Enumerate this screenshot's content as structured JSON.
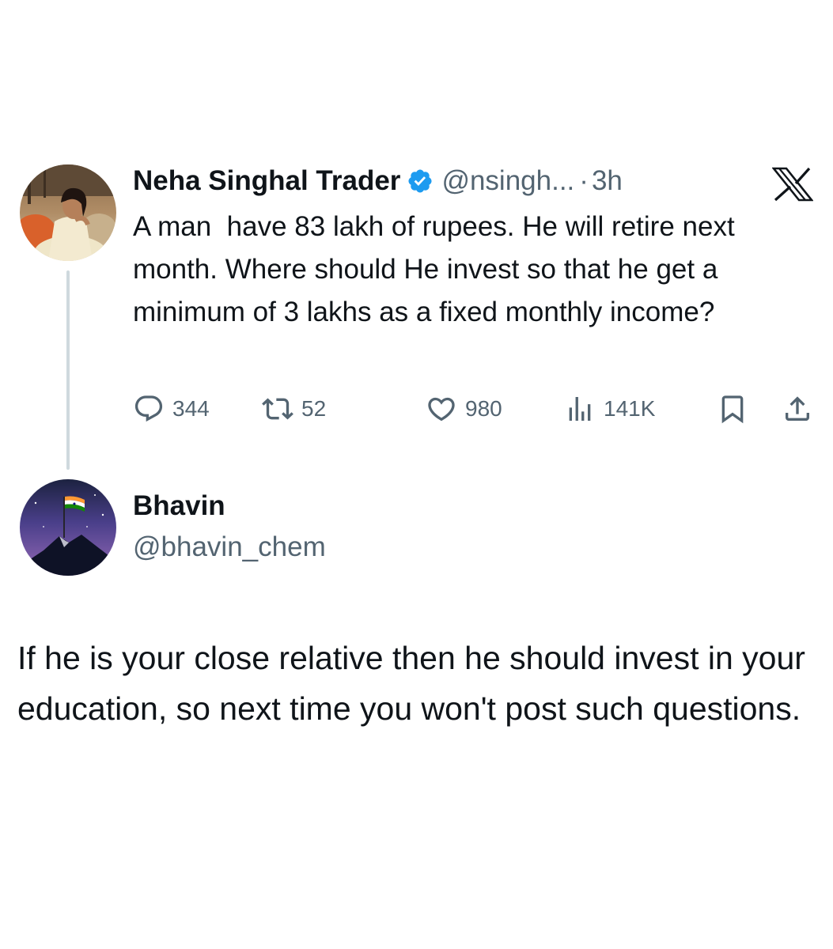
{
  "original_tweet": {
    "author_name": "Neha Singhal Trader",
    "handle": "@nsingh...",
    "separator": "·",
    "time": "3h",
    "verified": true,
    "text": "A man  have 83 lakh of rupees. He will retire next month. Where should He invest so that he get a minimum of 3 lakhs as a fixed monthly income?",
    "actions": {
      "replies": "344",
      "retweets": "52",
      "likes": "980",
      "views": "141K"
    }
  },
  "reply": {
    "author_name": "Bhavin",
    "handle": "@bhavin_chem",
    "text": "If he is your close relative then he should invest in your education, so next time you won't post such questions."
  },
  "icons": {
    "brand": "x-logo-icon",
    "verified": "verified-badge-icon",
    "reply": "reply-icon",
    "retweet": "retweet-icon",
    "like": "heart-icon",
    "views": "views-icon",
    "bookmark": "bookmark-icon",
    "share": "share-icon"
  },
  "colors": {
    "text_primary": "#0f1419",
    "text_secondary": "#536471",
    "verified_blue": "#1d9bf0",
    "thread_line": "#cfd9de"
  }
}
